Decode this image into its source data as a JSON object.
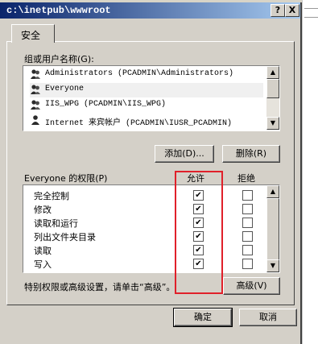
{
  "window": {
    "title": "c:\\inetpub\\wwwroot",
    "help_label": "?",
    "close_label": "X"
  },
  "tab": {
    "label": "安全"
  },
  "groups": {
    "label": "组或用户名称(G):",
    "items": [
      {
        "name": "Administrators (PCADMIN\\Administrators)",
        "icon": "user-group-icon"
      },
      {
        "name": "Everyone",
        "icon": "user-group-icon",
        "selected": true
      },
      {
        "name": "IIS_WPG (PCADMIN\\IIS_WPG)",
        "icon": "user-group-icon"
      },
      {
        "name": "Internet 来宾帐户 (PCADMIN\\IUSR_PCADMIN)",
        "icon": "user-icon"
      }
    ]
  },
  "buttons": {
    "add": "添加(D)...",
    "remove": "删除(R)",
    "advanced": "高级(V)",
    "ok": "确定",
    "cancel": "取消"
  },
  "permissions": {
    "label": "Everyone 的权限(P)",
    "allow_header": "允许",
    "deny_header": "拒绝",
    "rows": [
      {
        "name": "完全控制",
        "allow": true,
        "deny": false
      },
      {
        "name": "修改",
        "allow": true,
        "deny": false
      },
      {
        "name": "读取和运行",
        "allow": true,
        "deny": false
      },
      {
        "name": "列出文件夹目录",
        "allow": true,
        "deny": false
      },
      {
        "name": "读取",
        "allow": true,
        "deny": false
      },
      {
        "name": "写入",
        "allow": true,
        "deny": false
      }
    ]
  },
  "special_note": "特别权限或高级设置，请单击“高级”。",
  "colors": {
    "highlight_box": "#e0202a",
    "title_bar": "#0a246a",
    "dialog_bg": "#d4d0c8"
  }
}
